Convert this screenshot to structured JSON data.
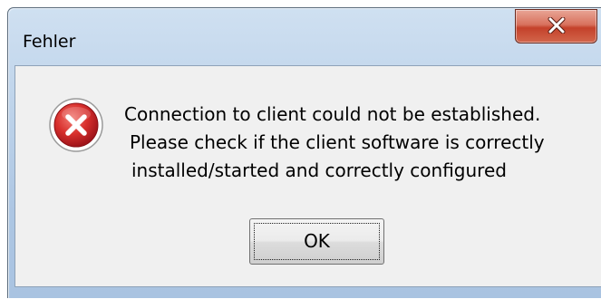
{
  "window": {
    "title": "Fehler"
  },
  "titlebar": {
    "close_icon": "close-icon",
    "close_color": "#c4412a"
  },
  "message": {
    "icon": "error-icon",
    "icon_color": "#c8242a",
    "lines": [
      "Connection to client could not be established.",
      "Please check if the client software is correctly",
      "installed/started and correctly configured"
    ]
  },
  "buttons": {
    "ok_label": "OK"
  }
}
